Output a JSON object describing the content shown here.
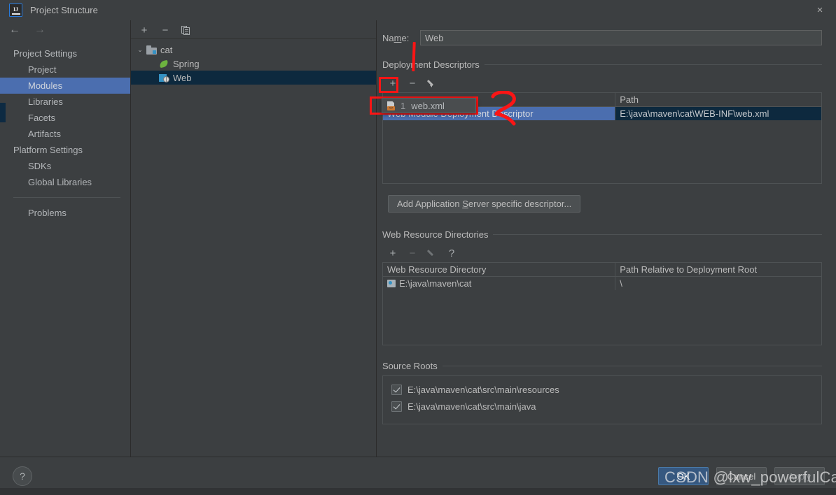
{
  "window": {
    "title": "Project Structure",
    "logo_text": "IJ",
    "close_icon": "×"
  },
  "sidebar": {
    "nav": {
      "back_icon": "←",
      "forward_icon": "→"
    },
    "groups": [
      {
        "label": "Project Settings",
        "items": [
          {
            "label": "Project",
            "selected": false
          },
          {
            "label": "Modules",
            "selected": true
          },
          {
            "label": "Libraries",
            "selected": false
          },
          {
            "label": "Facets",
            "selected": false
          },
          {
            "label": "Artifacts",
            "selected": false
          }
        ]
      },
      {
        "label": "Platform Settings",
        "items": [
          {
            "label": "SDKs",
            "selected": false
          },
          {
            "label": "Global Libraries",
            "selected": false
          }
        ]
      }
    ],
    "problems_label": "Problems"
  },
  "module_tree": {
    "toolbar": {
      "add": "+",
      "remove": "−",
      "copy_icon": "copy-icon"
    },
    "nodes": [
      {
        "label": "cat",
        "icon": "module-group-folder-icon",
        "expanded": true,
        "depth": 0,
        "selected": false,
        "twisty": "⌄"
      },
      {
        "label": "Spring",
        "icon": "spring-facet-icon",
        "depth": 1,
        "selected": false
      },
      {
        "label": "Web",
        "icon": "web-facet-icon",
        "depth": 1,
        "selected": true
      }
    ]
  },
  "module_editor": {
    "name_label_before": "Na",
    "name_label_mnemonic": "m",
    "name_label_after": "e:",
    "name_value": "Web",
    "deployment_descriptors": {
      "title": "Deployment Descriptors",
      "toolbar": {
        "add": "+",
        "remove": "−",
        "edit_icon": "pencil-icon"
      },
      "columns": [
        "",
        "Path"
      ],
      "rows": [
        {
          "name": "Web Module Deployment Descriptor",
          "path": "E:\\java\\maven\\cat\\WEB-INF\\web.xml",
          "selected": true
        }
      ],
      "add_popup": {
        "visible": true,
        "items": [
          {
            "index": "1",
            "label": "web.xml",
            "icon": "xml-file-icon",
            "tag_text": "<>"
          }
        ]
      },
      "add_server_descriptor_button": {
        "before": "Add Application ",
        "mnemonic": "S",
        "after": "erver specific descriptor..."
      }
    },
    "web_resource_directories": {
      "title": "Web Resource Directories",
      "toolbar": {
        "add": "+",
        "remove": "−",
        "edit_icon": "pencil-icon",
        "help": "?"
      },
      "columns": [
        "Web Resource Directory",
        "Path Relative to Deployment Root"
      ],
      "rows": [
        {
          "directory": "E:\\java\\maven\\cat",
          "relative_path": "\\"
        }
      ]
    },
    "source_roots": {
      "title": "Source Roots",
      "items": [
        {
          "path": "E:\\java\\maven\\cat\\src\\main\\resources",
          "checked": true
        },
        {
          "path": "E:\\java\\maven\\cat\\src\\main\\java",
          "checked": true
        }
      ]
    }
  },
  "footer": {
    "help_icon": "?",
    "buttons": [
      {
        "label": "OK",
        "style": "primary"
      },
      {
        "label": "Cancel",
        "style": "default"
      },
      {
        "label": "Apply",
        "style": "disabled"
      }
    ]
  },
  "watermark": {
    "text": "CSDN @lxw_powerfulCat"
  },
  "annotations": {
    "color": "#fb1515",
    "marks": [
      {
        "name": "line-to-deployment-descriptors",
        "shape": "vertical-stroke"
      },
      {
        "name": "highlight-add-button",
        "shape": "rectangle"
      },
      {
        "name": "highlight-web-xml-popup-item",
        "shape": "rectangle"
      },
      {
        "name": "step-number-two",
        "shape": "handwritten-2",
        "text": "2"
      }
    ]
  },
  "colors": {
    "bg": "#3c3f41",
    "selection_blue": "#4b6eaf",
    "selection_navy": "#0d293e",
    "accent_blue": "#3592c4",
    "annotation_red": "#fb1515",
    "primary_button": "#365880"
  }
}
